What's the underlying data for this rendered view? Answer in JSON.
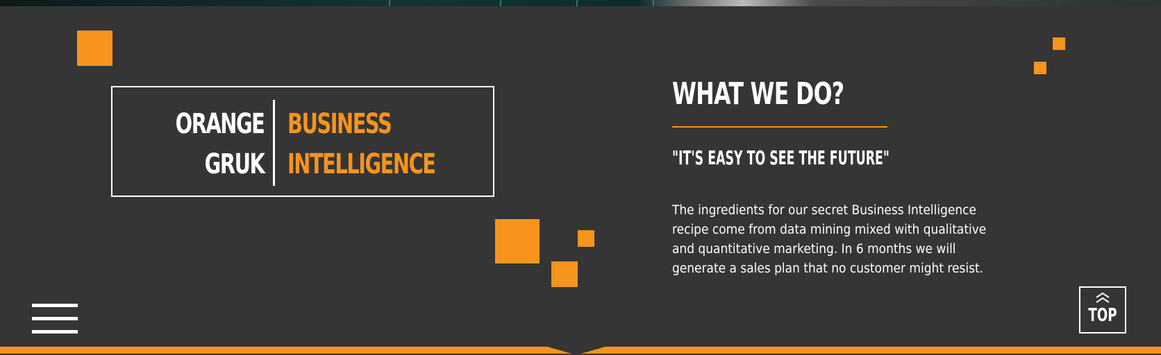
{
  "logo": {
    "word1_line1": "ORANGE",
    "word1_line2": "GRUK",
    "word2_line1": "BUSINESS",
    "word2_line2": "INTELLIGENCE"
  },
  "section": {
    "heading": "WHAT WE DO?",
    "quote": "\"IT'S EASY TO SEE THE FUTURE\"",
    "description": "The ingredients for our secret Business Intelligence recipe come from data mining mixed with qualitative and quantitative marketing. In 6 months we will generate a sales plan that no customer might resist."
  },
  "top_button": {
    "label": "TOP"
  },
  "colors": {
    "accent": "#f7941d",
    "background": "#353535",
    "text": "#ffffff"
  },
  "icons": {
    "menu": "hamburger-menu-icon",
    "top": "double-chevron-up-icon"
  }
}
